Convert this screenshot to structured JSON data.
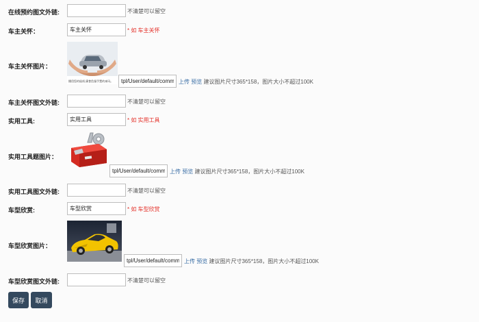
{
  "form": {
    "online_booking_link": {
      "label": "在线预约图文外链:",
      "value": "",
      "hint": "不清楚可以留空"
    },
    "owner_care": {
      "label": "车主关怀：",
      "value": "车主关怀",
      "hint": "* 如 车主关怀"
    },
    "owner_care_image": {
      "label": "车主关怀图片：",
      "caption": "播用您的极线,康食危服手置的来玛。",
      "path": "tpl/User/default/common",
      "upload": "上传",
      "preview": "预览",
      "size_hint": "建议图片尺寸365*158，图片大小不超过100K"
    },
    "owner_care_link": {
      "label": "车主关怀图文外链:",
      "value": "",
      "hint": "不清楚可以留空"
    },
    "tools": {
      "label": "实用工具:",
      "value": "实用工具",
      "hint": "* 如 实用工具"
    },
    "tools_image": {
      "label": "实用工具题图片：",
      "path": "tpl/User/default/common",
      "upload": "上传",
      "preview": "预览",
      "size_hint": "建议图片尺寸365*158，图片大小不超过100K"
    },
    "tools_link": {
      "label": "实用工具图文外链:",
      "value": "",
      "hint": "不清楚可以留空"
    },
    "car_showcase": {
      "label": "车型欣赏:",
      "value": "车型欣赏",
      "hint": "* 如 车型欣赏"
    },
    "car_showcase_image": {
      "label": "车型欣赏图片：",
      "path": "tpl/User/default/common",
      "upload": "上传",
      "preview": "预览",
      "size_hint": "建议图片尺寸365*158，图片大小不超过100K"
    },
    "car_showcase_link": {
      "label": "车型欣赏图文外链:",
      "value": "",
      "hint": "不清楚可以留空"
    }
  },
  "buttons": {
    "save": "保存",
    "cancel": "取消"
  },
  "colors": {
    "button_bg": "#34495e",
    "required_red": "#e4312a",
    "link_blue": "#3a6ea5"
  },
  "icons": {
    "owner_care": "hands-holding-car-image",
    "tools": "red-toolbox-image",
    "car": "yellow-sports-car-image"
  }
}
